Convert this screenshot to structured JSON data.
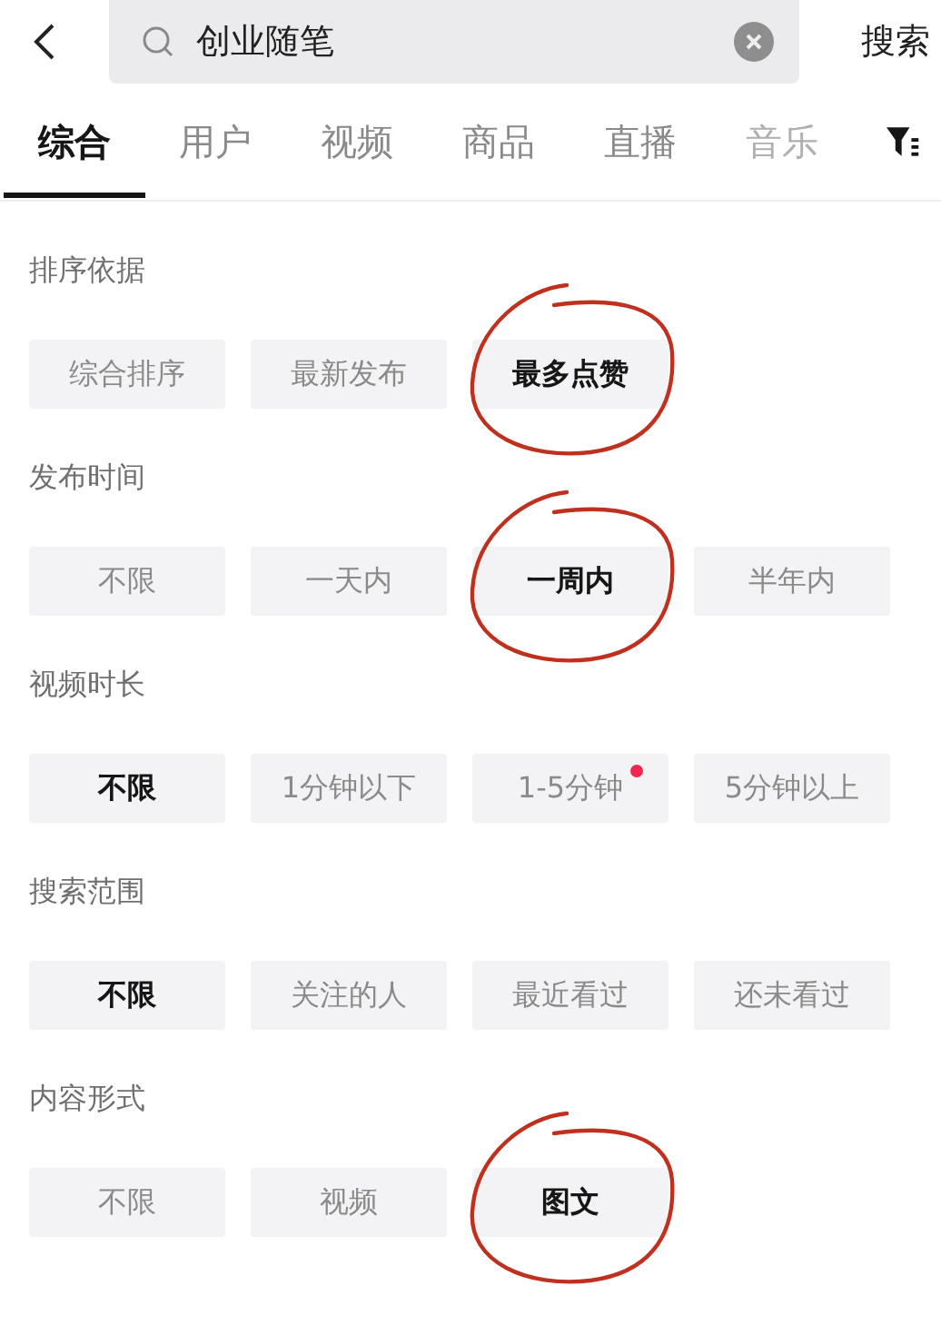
{
  "search": {
    "value": "创业随笔",
    "button": "搜索"
  },
  "tabs": [
    {
      "label": "综合",
      "selected": true,
      "faded": false
    },
    {
      "label": "用户",
      "selected": false,
      "faded": false
    },
    {
      "label": "视频",
      "selected": false,
      "faded": false
    },
    {
      "label": "商品",
      "selected": false,
      "faded": false
    },
    {
      "label": "直播",
      "selected": false,
      "faded": false
    },
    {
      "label": "音乐",
      "selected": false,
      "faded": true
    }
  ],
  "sections": [
    {
      "title": "排序依据",
      "options": [
        {
          "label": "综合排序",
          "selected": false,
          "circled": false,
          "dot": false
        },
        {
          "label": "最新发布",
          "selected": false,
          "circled": false,
          "dot": false
        },
        {
          "label": "最多点赞",
          "selected": true,
          "circled": true,
          "dot": false
        }
      ]
    },
    {
      "title": "发布时间",
      "options": [
        {
          "label": "不限",
          "selected": false,
          "circled": false,
          "dot": false
        },
        {
          "label": "一天内",
          "selected": false,
          "circled": false,
          "dot": false
        },
        {
          "label": "一周内",
          "selected": true,
          "circled": true,
          "dot": false
        },
        {
          "label": "半年内",
          "selected": false,
          "circled": false,
          "dot": false
        }
      ]
    },
    {
      "title": "视频时长",
      "options": [
        {
          "label": "不限",
          "selected": true,
          "circled": false,
          "dot": false
        },
        {
          "label": "1分钟以下",
          "selected": false,
          "circled": false,
          "dot": false
        },
        {
          "label": "1-5分钟",
          "selected": false,
          "circled": false,
          "dot": true
        },
        {
          "label": "5分钟以上",
          "selected": false,
          "circled": false,
          "dot": false
        }
      ]
    },
    {
      "title": "搜索范围",
      "options": [
        {
          "label": "不限",
          "selected": true,
          "circled": false,
          "dot": false
        },
        {
          "label": "关注的人",
          "selected": false,
          "circled": false,
          "dot": false
        },
        {
          "label": "最近看过",
          "selected": false,
          "circled": false,
          "dot": false
        },
        {
          "label": "还未看过",
          "selected": false,
          "circled": false,
          "dot": false
        }
      ]
    },
    {
      "title": "内容形式",
      "options": [
        {
          "label": "不限",
          "selected": false,
          "circled": false,
          "dot": false
        },
        {
          "label": "视频",
          "selected": false,
          "circled": false,
          "dot": false
        },
        {
          "label": "图文",
          "selected": true,
          "circled": true,
          "dot": false
        }
      ]
    }
  ]
}
